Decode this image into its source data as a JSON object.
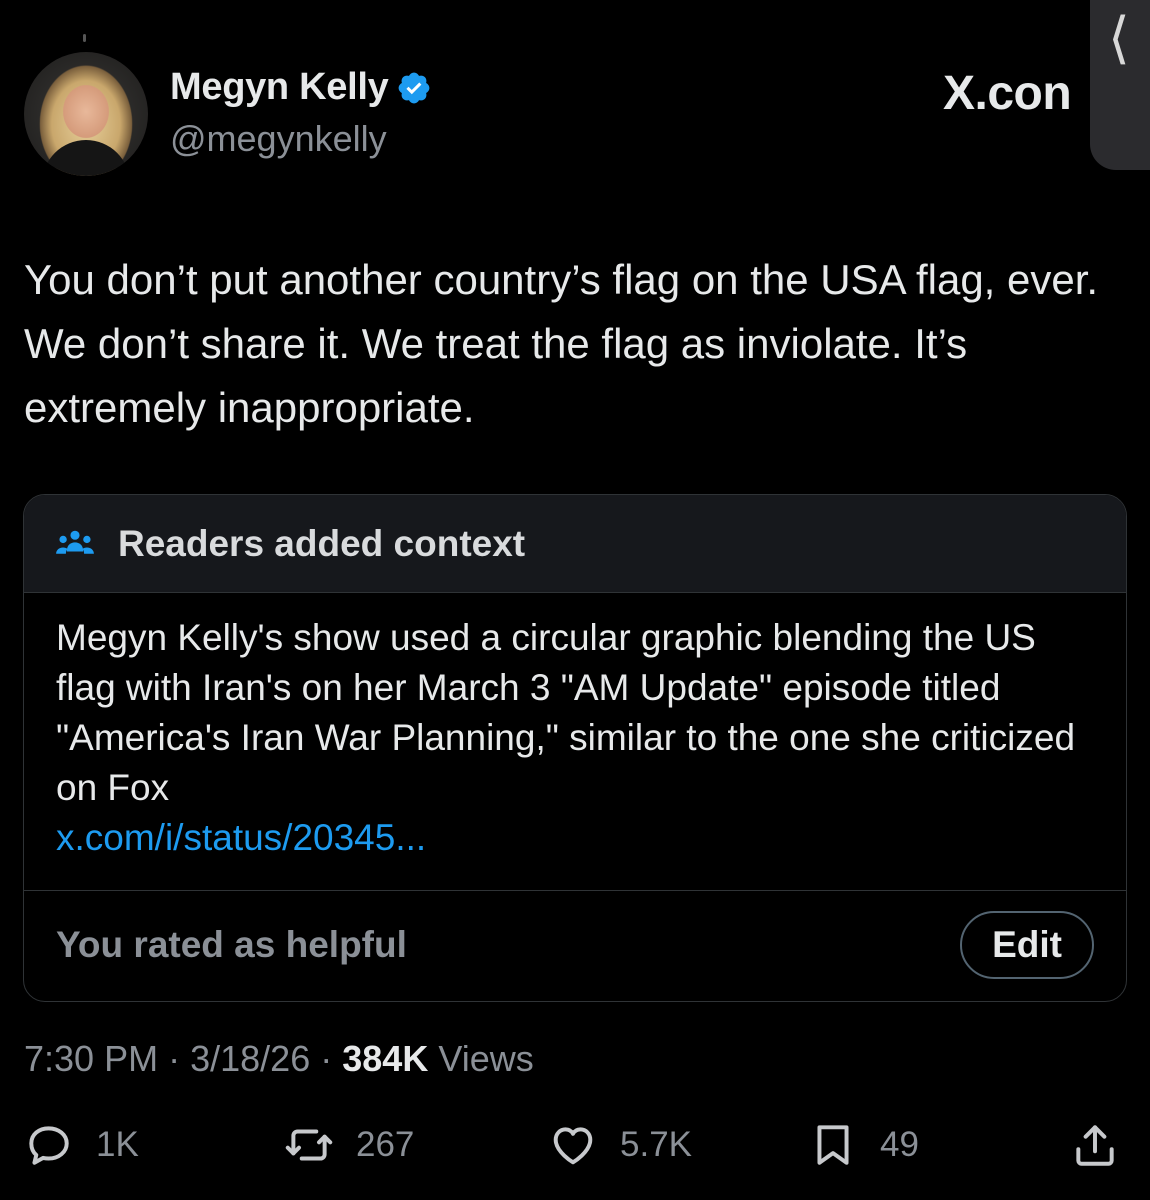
{
  "tweet": {
    "author_name": "Megyn Kelly",
    "handle": "@megynkelly",
    "watermark": "X.con",
    "text": "You don’t put another country’s flag on the USA flag, ever. We don’t share it. We treat the flag as inviolate. It’s extremely inappropriate.",
    "side_tab_glyph": "⟨"
  },
  "community_note": {
    "header": "Readers added context",
    "body": "Megyn Kelly's show used a circular graphic blending the US flag with Iran's on her March 3 \"AM Update\" episode titled \"America's Iran War Planning,\"  similar to the one she criticized on Fox",
    "link": "x.com/i/status/20345...",
    "rating_status": "You rated as helpful",
    "edit_label": "Edit"
  },
  "meta": {
    "time": "7:30 PM",
    "date": "3/18/26",
    "views_count": "384K",
    "views_label": "Views",
    "separator": "·"
  },
  "actions": {
    "replies": "1K",
    "reposts": "267",
    "likes": "5.7K",
    "bookmarks": "49"
  },
  "colors": {
    "background": "#000000",
    "text": "#e7e9ea",
    "secondary": "#8b9097",
    "link": "#1d9bf0",
    "verified": "#1d9bf0",
    "border": "#2f3336"
  },
  "icons": [
    "verified-badge-icon",
    "people-icon",
    "reply-icon",
    "repost-icon",
    "like-icon",
    "bookmark-icon",
    "share-icon"
  ]
}
